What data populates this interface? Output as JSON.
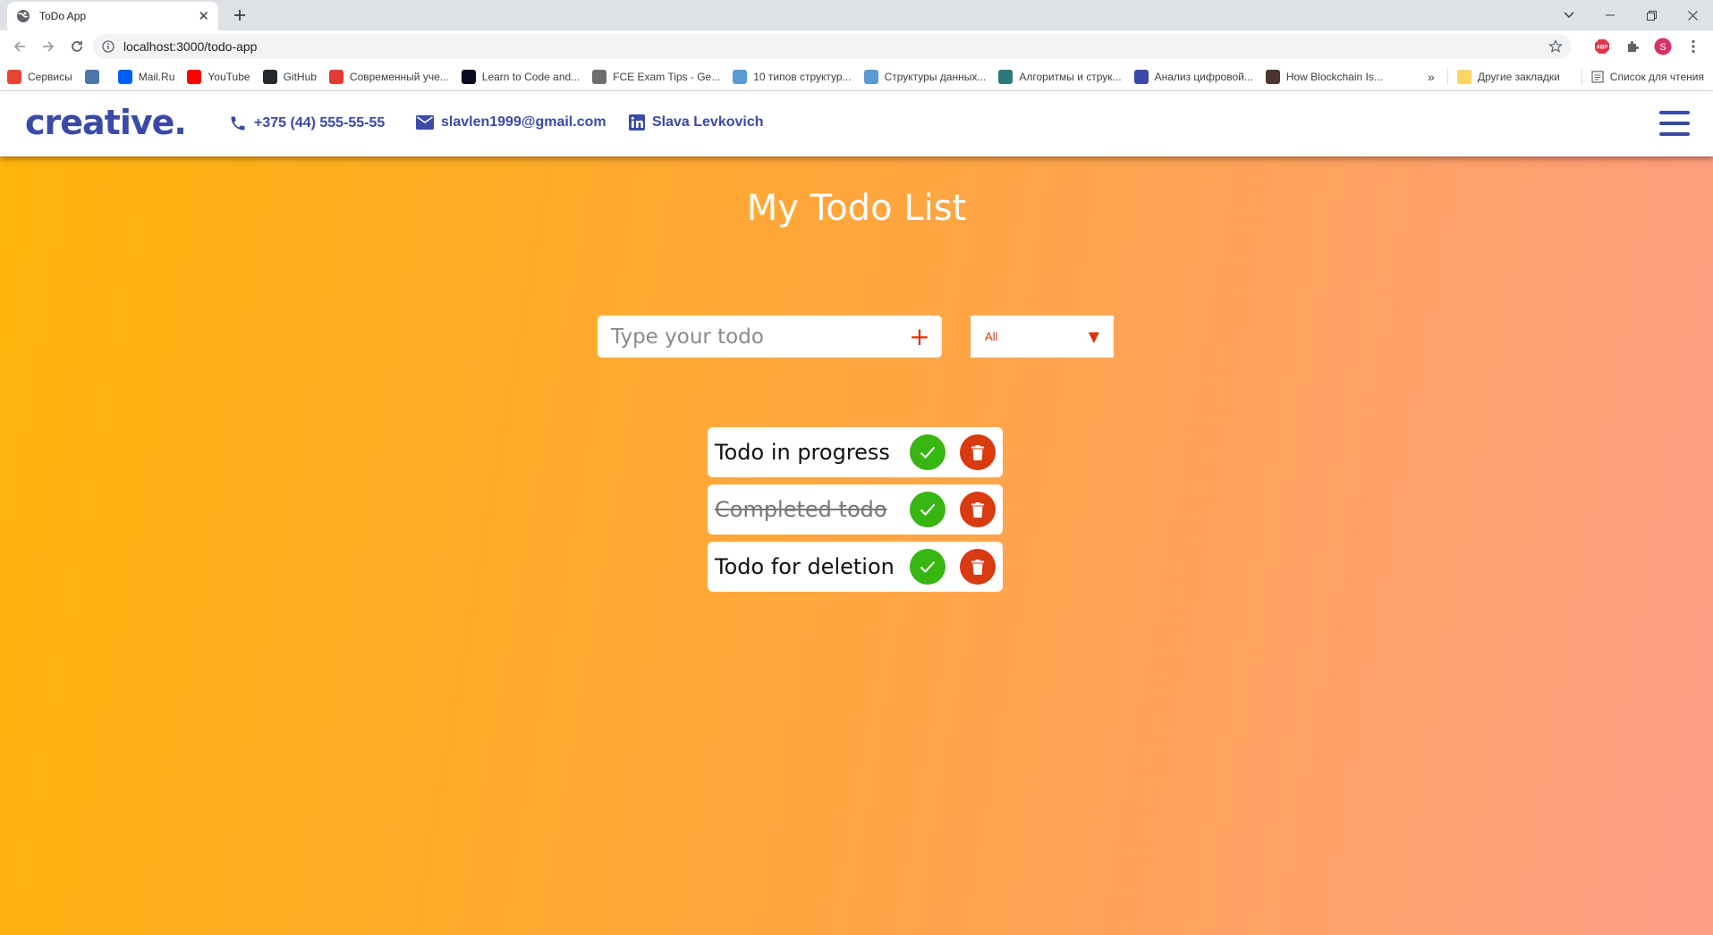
{
  "browser": {
    "tab_title": "ToDo App",
    "url": "localhost:3000/todo-app",
    "profile_initial": "S",
    "adblock_label": "ABP",
    "bookmarks": [
      {
        "label": "Сервисы",
        "icon": "apps-grid-icon",
        "color": "#ea4335"
      },
      {
        "label": "",
        "icon": "vk-icon",
        "color": "#4a76a8"
      },
      {
        "label": "Mail.Ru",
        "icon": "mailru-icon",
        "color": "#005ff9"
      },
      {
        "label": "YouTube",
        "icon": "youtube-icon",
        "color": "#ff0000"
      },
      {
        "label": "GitHub",
        "icon": "github-icon",
        "color": "#24292e"
      },
      {
        "label": "Современный уче...",
        "icon": "js-learn-icon",
        "color": "#e53935"
      },
      {
        "label": "Learn to Code and...",
        "icon": "fcc-icon",
        "color": "#0a0a23"
      },
      {
        "label": "FCE Exam Tips - Ge...",
        "icon": "fce-icon",
        "color": "#6d6d6d"
      },
      {
        "label": "10 типов структур...",
        "icon": "habr-icon",
        "color": "#5a9bd5"
      },
      {
        "label": "Структуры данных...",
        "icon": "habr-icon",
        "color": "#5a9bd5"
      },
      {
        "label": "Алгоритмы и струк...",
        "icon": "algo-icon",
        "color": "#2b7a78"
      },
      {
        "label": "Анализ цифровой...",
        "icon": "analysis-icon",
        "color": "#3949ab"
      },
      {
        "label": "How Blockchain Is...",
        "icon": "blockchain-icon",
        "color": "#4e342e"
      }
    ],
    "more_bookmarks": "»",
    "other_bookmarks": "Другие закладки",
    "reading_list": "Список для чтения"
  },
  "site": {
    "logo": "creative.",
    "phone": "+375 (44) 555-55-55",
    "email": "slavlen1999@gmail.com",
    "linkedin": "Slava Levkovich"
  },
  "app": {
    "title": "My Todo List",
    "input_placeholder": "Type your todo",
    "add_symbol": "+",
    "filter_value": "All",
    "filter_caret": "▼",
    "todos": [
      {
        "text": "Todo in progress",
        "completed": false
      },
      {
        "text": "Completed todo",
        "completed": true
      },
      {
        "text": "Todo for deletion",
        "completed": false
      }
    ]
  },
  "colors": {
    "brand": "#3a4aa6",
    "accent_red": "#da3a10",
    "accent_green": "#37b612",
    "gradient_start": "#ffb40a",
    "gradient_end": "#fe9c86"
  }
}
